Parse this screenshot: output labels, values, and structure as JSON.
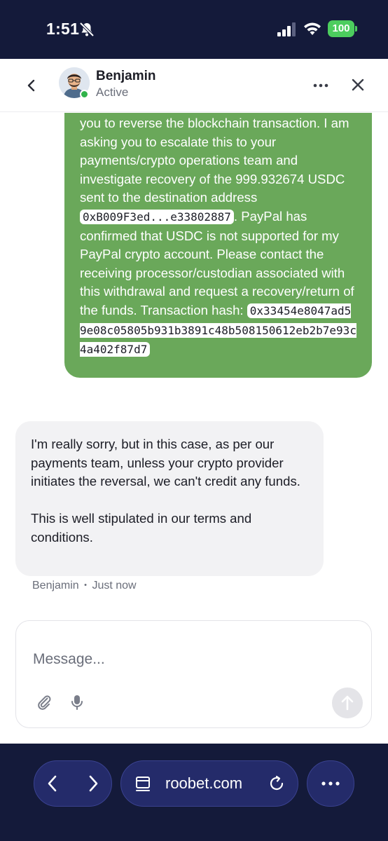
{
  "status_bar": {
    "time": "1:51",
    "battery": "100"
  },
  "header": {
    "agent_name": "Benjamin",
    "agent_status": "Active"
  },
  "messages": {
    "user": {
      "text_before_address": "you to reverse the blockchain transaction. I am asking you to escalate this to your payments/crypto operations team and investigate recovery of the 999.932674 USDC sent to the destination address",
      "address": "0xB009F3ed...e33802887",
      "text_after_address": ". PayPal has confirmed that USDC is not supported for my PayPal crypto account. Please contact the receiving processor/custodian associated with this withdrawal and request a recovery/return of the funds. Transaction hash:",
      "tx_hash": "0x33454e8047ad59e08c05805b931b3891c48b508150612eb2b7e93c4a402f87d7"
    },
    "agent": {
      "paragraph_1": "I'm really sorry, but in this case, as per our payments team, unless your crypto provider initiates the reversal, we can't credit any funds.",
      "paragraph_2": "This is well stipulated in our terms and conditions.",
      "author": "Benjamin",
      "separator": "•",
      "time": "Just now"
    }
  },
  "composer": {
    "placeholder": "Message..."
  },
  "browser": {
    "url": "roobet.com"
  },
  "colors": {
    "user_bubble": "#6aa85a",
    "agent_bubble": "#f2f2f4",
    "browser_bg": "#141a3a",
    "online": "#30b34a"
  }
}
